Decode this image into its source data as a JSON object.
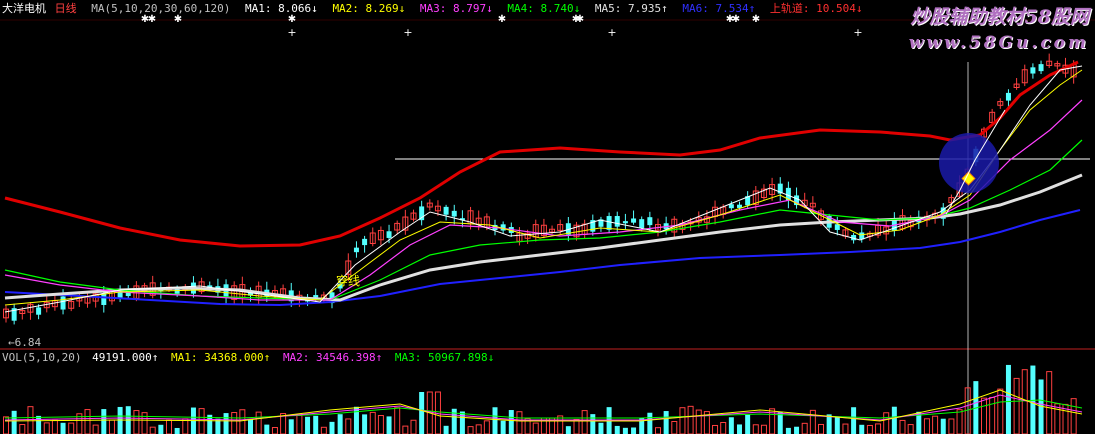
{
  "header": {
    "stock_name": "大洋电机",
    "period": "日线",
    "ma_params": "MA(5,10,20,30,60,120)",
    "ma1": "MA1: 8.066↓",
    "ma2": "MA2: 8.269↓",
    "ma3": "MA3: 8.797↓",
    "ma4": "MA4: 8.740↓",
    "ma5": "MA5: 7.935↑",
    "ma6": "MA6: 7.534↑",
    "upper_track": "上轨道: 10.504↓"
  },
  "watermark": {
    "line1": "炒股辅助教材58股网",
    "line2": "www.58Gu.com"
  },
  "price_panel": {
    "low_label": "←6.84",
    "marker_label": "穿线"
  },
  "volume_panel": {
    "params": "VOL(5,10,20)",
    "vol": "49191.000↑",
    "ma1": "MA1: 34368.000↑",
    "ma2": "MA2: 34546.398↑",
    "ma3": "MA3: 50967.898↓"
  },
  "colors": {
    "background": "#000000",
    "up_candle": "#ff4040",
    "down_candle": "#54ffff",
    "ma1": "#ffffff",
    "ma2": "#ffff00",
    "ma3": "#ff40ff",
    "ma4": "#00ff00",
    "ma5": "#e0e0e0",
    "ma6": "#2020ff",
    "upper_track": "#e00000",
    "circle": "#1a1aa8"
  },
  "chart_data": {
    "type": "candlestick",
    "title": "大洋电机 日线",
    "low_price": 6.84,
    "upper_track_last": 10.504,
    "ma_last": {
      "MA1": 8.066,
      "MA2": 8.269,
      "MA3": 8.797,
      "MA4": 8.74,
      "MA5": 7.935,
      "MA6": 7.534
    },
    "volume_last": {
      "VOL": 49191.0,
      "MA1": 34368.0,
      "MA2": 34546.398,
      "MA3": 50967.898
    },
    "grid": false
  }
}
